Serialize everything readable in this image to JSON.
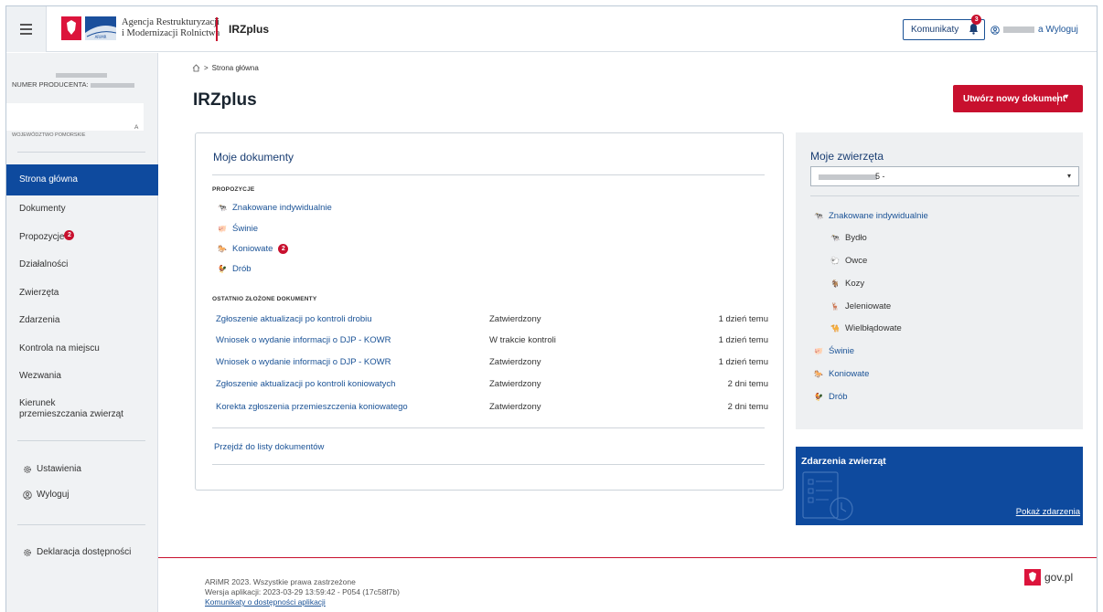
{
  "header": {
    "agency_line1": "Agencja Restrukturyzacji",
    "agency_line2": "i Modernizacji Rolnictwa",
    "app_name": "IRZplus",
    "notifications_label": "Komunikaty",
    "notifications_count": "3",
    "logout_label": "a Wyloguj",
    "logo_text": "ARiMR"
  },
  "sidebar": {
    "producer_label": "NUMER PRODUCENTA:",
    "producer_extra1": "A",
    "producer_extra2": "WOJEWÓDZTWO POMORSKIE",
    "nav": [
      {
        "label": "Strona główna"
      },
      {
        "label": "Dokumenty"
      },
      {
        "label": "Propozycje",
        "badge": "2"
      },
      {
        "label": "Działalności"
      },
      {
        "label": "Zwierzęta"
      },
      {
        "label": "Zdarzenia"
      },
      {
        "label": "Kontrola na miejscu"
      },
      {
        "label": "Wezwania"
      },
      {
        "label": "Kierunek przemieszczania zwierząt"
      }
    ],
    "settings_label": "Ustawienia",
    "logout_label": "Wyloguj",
    "accessibility_label": "Deklaracja dostępności"
  },
  "breadcrumb": {
    "home": "Strona główna"
  },
  "page_title": "IRZplus",
  "new_document_label": "Utwórz nowy dokument",
  "documents_card": {
    "title": "Moje dokumenty",
    "proposals_title": "PROPOZYCJE",
    "proposals": [
      {
        "label": "Znakowane indywidualnie",
        "icon": "cattle-icon"
      },
      {
        "label": "Świnie",
        "icon": "pig-icon"
      },
      {
        "label": "Koniowate",
        "icon": "horse-icon",
        "badge": "2"
      },
      {
        "label": "Drób",
        "icon": "poultry-icon"
      }
    ],
    "recent_title": "OSTATNIO ZŁOŻONE DOKUMENTY",
    "recent": [
      {
        "name": "Zgłoszenie aktualizacji po kontroli drobiu",
        "status": "Zatwierdzony",
        "when": "1 dzień temu"
      },
      {
        "name": "Wniosek o wydanie informacji o DJP - KOWR",
        "status": "W trakcie kontroli",
        "when": "1 dzień temu"
      },
      {
        "name": "Wniosek o wydanie informacji o DJP - KOWR",
        "status": "Zatwierdzony",
        "when": "1 dzień temu"
      },
      {
        "name": "Zgłoszenie aktualizacji po kontroli koniowatych",
        "status": "Zatwierdzony",
        "when": "2 dni temu"
      },
      {
        "name": "Korekta zgłoszenia przemieszczenia koniowatego",
        "status": "Zatwierdzony",
        "when": "2 dni temu"
      }
    ],
    "all_documents_link": "Przejdź do listy dokumentów"
  },
  "animals_card": {
    "title": "Moje zwierzęta",
    "select_value": "5 -",
    "group_label": "Znakowane indywidualnie",
    "sub_items": [
      "Bydło",
      "Owce",
      "Kozy",
      "Jeleniowate",
      "Wielbłądowate"
    ],
    "other_items": [
      "Świnie",
      "Koniowate",
      "Drób"
    ]
  },
  "events_card": {
    "title": "Zdarzenia zwierząt",
    "link": "Pokaż zdarzenia"
  },
  "footer": {
    "copyright": "ARiMR 2023. Wszystkie prawa zastrzeżone",
    "version": "Wersja aplikacji: 2023-03-29 13:59:42 - P054 (17c58f7b)",
    "accessibility_link": "Komunikaty o dostępności aplikacji",
    "gov_label": "gov.pl"
  },
  "colors": {
    "primary": "#0e4a9e",
    "accent_red": "#c8102e",
    "link": "#1a5296"
  }
}
